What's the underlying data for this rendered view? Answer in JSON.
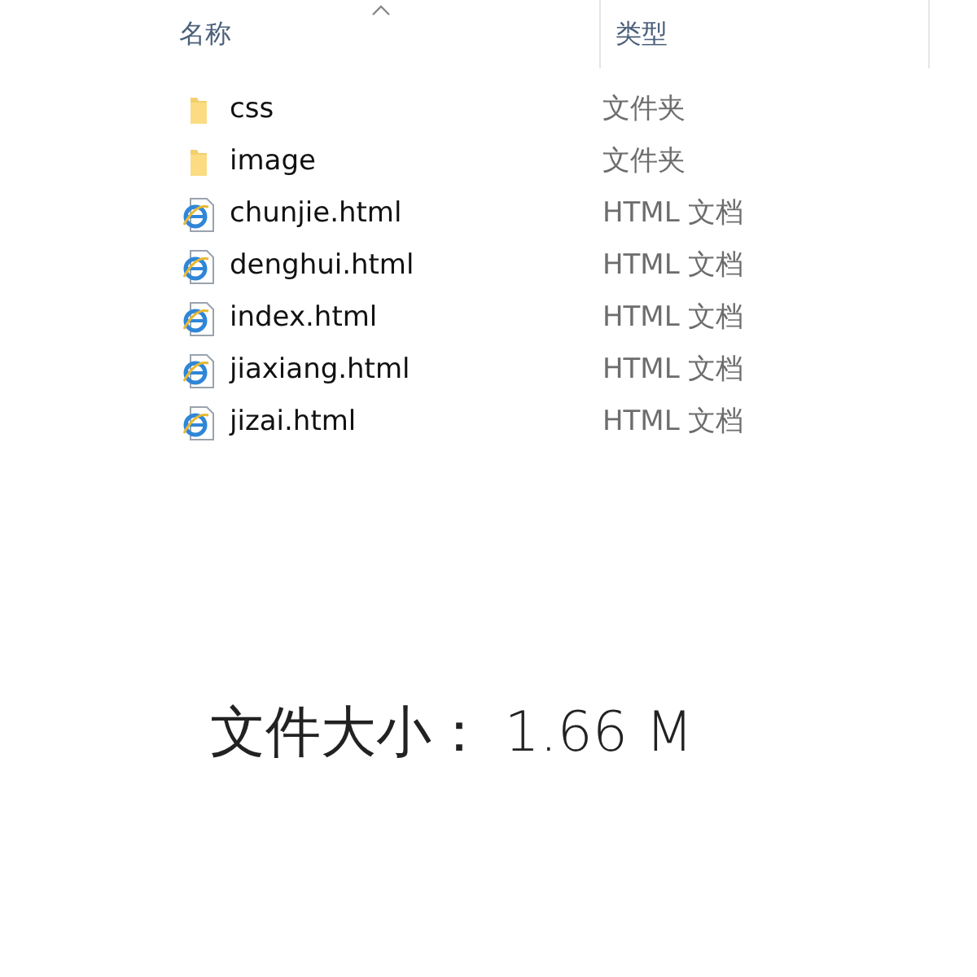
{
  "columns": [
    {
      "label": "名称",
      "sorted": true
    },
    {
      "label": "类型",
      "sorted": false
    }
  ],
  "files": [
    {
      "name": "css",
      "type": "文件夹",
      "kind": "folder"
    },
    {
      "name": "image",
      "type": "文件夹",
      "kind": "folder"
    },
    {
      "name": "chunjie.html",
      "type": "HTML 文档",
      "kind": "html"
    },
    {
      "name": "denghui.html",
      "type": "HTML 文档",
      "kind": "html"
    },
    {
      "name": "index.html",
      "type": "HTML 文档",
      "kind": "html"
    },
    {
      "name": "jiaxiang.html",
      "type": "HTML 文档",
      "kind": "html"
    },
    {
      "name": "jizai.html",
      "type": "HTML 文档",
      "kind": "html"
    }
  ],
  "caption": "文件大小： 1.66 M"
}
